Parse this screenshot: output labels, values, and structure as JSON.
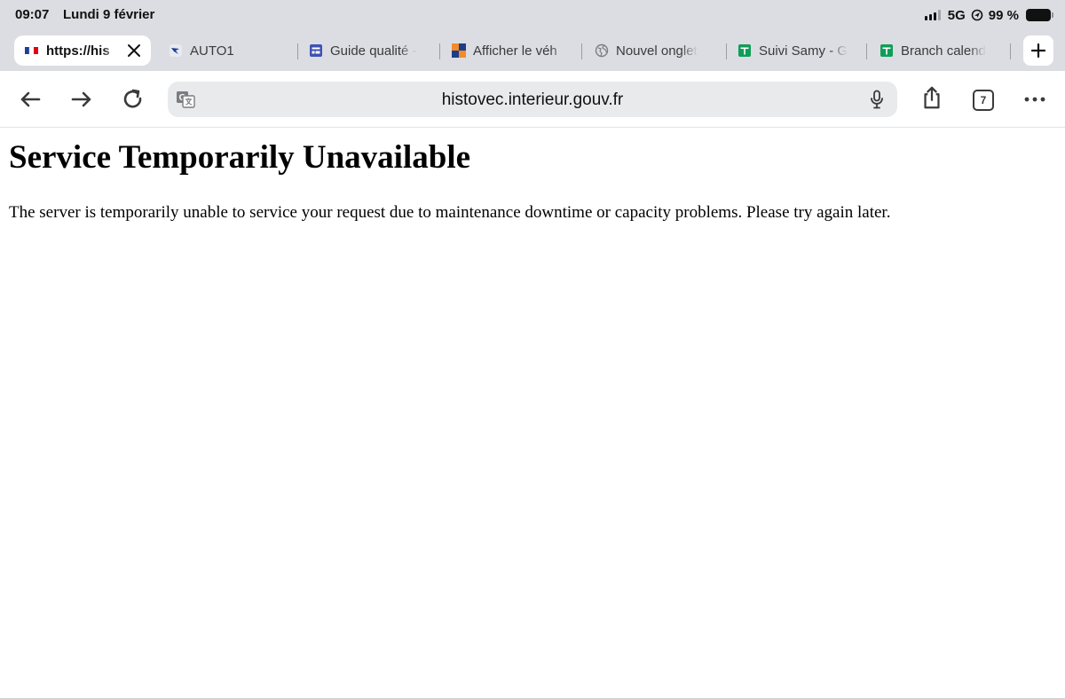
{
  "status_bar": {
    "time": "09:07",
    "date": "Lundi 9 février",
    "network": "5G",
    "battery": "99 %",
    "signal_bars_active": 3,
    "signal_bars_total": 4
  },
  "tabs": [
    {
      "label": "https://his",
      "favicon": "french-flag-icon",
      "active": true
    },
    {
      "label": "AUTO1",
      "favicon": "auto1-bird-icon",
      "active": false
    },
    {
      "label": "Guide qualité -",
      "favicon": "forms-icon",
      "active": false
    },
    {
      "label": "Afficher le véh",
      "favicon": "orange-blue-squares-icon",
      "active": false
    },
    {
      "label": "Nouvel onglet",
      "favicon": "globe-icon",
      "active": false
    },
    {
      "label": "Suivi Samy - G",
      "favicon": "sheets-icon",
      "active": false
    },
    {
      "label": "Branch calend",
      "favicon": "sheets-icon",
      "active": false
    }
  ],
  "toolbar": {
    "url": "histovec.interieur.gouv.fr",
    "tab_count": "7"
  },
  "page": {
    "title": "Service Temporarily Unavailable",
    "message": "The server is temporarily unable to service your request due to maintenance downtime or capacity problems. Please try again later."
  },
  "colors": {
    "chrome_background": "#dcdde2",
    "address_bar": "#e9eaec",
    "sheets_green": "#0f9d58",
    "forms_blue": "#3f51b5"
  }
}
